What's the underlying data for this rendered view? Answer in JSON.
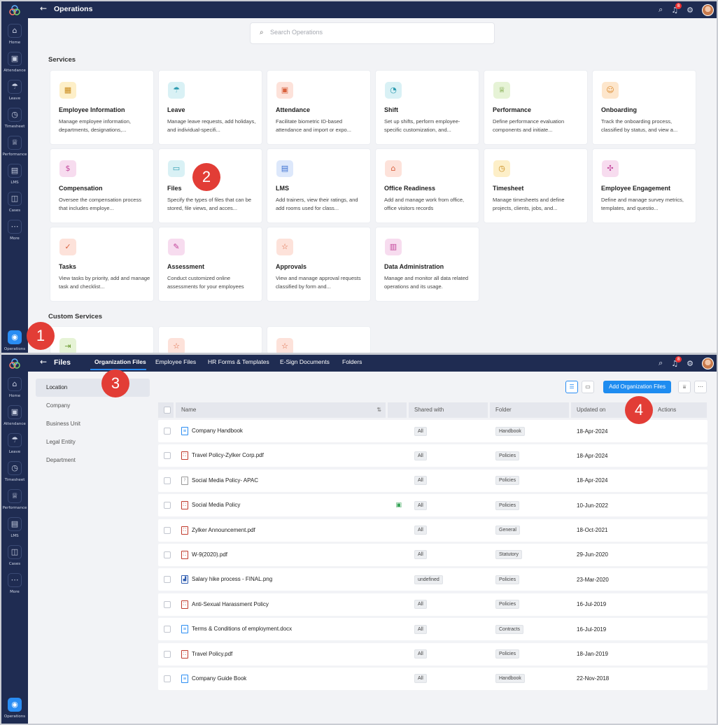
{
  "operations_view": {
    "rail": [
      {
        "label": "Home",
        "icon": "home-icon",
        "glyph": "⌂"
      },
      {
        "label": "Attendance",
        "icon": "calendar-icon",
        "glyph": "▣"
      },
      {
        "label": "Leave",
        "icon": "umbrella-icon",
        "glyph": "☂"
      },
      {
        "label": "Timesheet",
        "icon": "clock-icon",
        "glyph": "◷"
      },
      {
        "label": "Performance",
        "icon": "trophy-icon",
        "glyph": "♕"
      },
      {
        "label": "LMS",
        "icon": "monitor-icon",
        "glyph": "▤"
      },
      {
        "label": "Cases",
        "icon": "cases-icon",
        "glyph": "◫"
      },
      {
        "label": "More",
        "icon": "more-icon",
        "glyph": "⋯"
      }
    ],
    "rail_active": {
      "label": "Operations",
      "icon": "operations-icon",
      "glyph": "◉"
    },
    "title": "Operations",
    "notification_count": "8",
    "search_placeholder": "Search Operations",
    "services_title": "Services",
    "services": [
      {
        "title": "Employee Information",
        "desc": "Manage employee information, departments, designations,...",
        "icon": "id-card-icon",
        "glyph": "▦",
        "bg": "#fdefc8",
        "fg": "#c98a1a"
      },
      {
        "title": "Leave",
        "desc": "Manage leave requests, add holidays, and individual-specifi...",
        "icon": "umbrella-icon",
        "glyph": "☂",
        "bg": "#d9f1f5",
        "fg": "#2c9bb0"
      },
      {
        "title": "Attendance",
        "desc": "Facilitate biometric ID-based attendance and import or expo...",
        "icon": "calendar-icon",
        "glyph": "▣",
        "bg": "#fde2da",
        "fg": "#d9613e"
      },
      {
        "title": "Shift",
        "desc": "Set up shifts, perform employee-specific customization, and...",
        "icon": "shift-icon",
        "glyph": "◔",
        "bg": "#d9f1f5",
        "fg": "#2c9bb0"
      },
      {
        "title": "Performance",
        "desc": "Define performance evaluation components and initiate...",
        "icon": "trophy-icon",
        "glyph": "♕",
        "bg": "#e6f3d6",
        "fg": "#6a9a2e"
      },
      {
        "title": "Onboarding",
        "desc": "Track the onboarding process, classified by status, and view a...",
        "icon": "onboarding-icon",
        "glyph": "☺",
        "bg": "#fde6cc",
        "fg": "#d98526"
      },
      {
        "title": "Compensation",
        "desc": "Oversee the compensation process that includes employe...",
        "icon": "money-icon",
        "glyph": "$",
        "bg": "#f7dcef",
        "fg": "#c2449a"
      },
      {
        "title": "Files",
        "desc": "Specify the types of files that can be stored, file views, and acces...",
        "icon": "folder-icon",
        "glyph": "▭",
        "bg": "#d9f1f5",
        "fg": "#2c9bb0"
      },
      {
        "title": "LMS",
        "desc": "Add trainers, view their ratings, and add rooms used for class...",
        "icon": "monitor-icon",
        "glyph": "▤",
        "bg": "#dde8fb",
        "fg": "#3b6fd1"
      },
      {
        "title": "Office Readiness",
        "desc": "Add and manage work from office, office visitors records",
        "icon": "office-icon",
        "glyph": "⌂",
        "bg": "#fde2da",
        "fg": "#d9613e"
      },
      {
        "title": "Timesheet",
        "desc": "Manage timesheets and define projects, clients, jobs, and...",
        "icon": "clock-icon",
        "glyph": "◷",
        "bg": "#fdefc8",
        "fg": "#c98a1a"
      },
      {
        "title": "Employee Engagement",
        "desc": "Define and manage survey metrics, templates, and questio...",
        "icon": "engagement-icon",
        "glyph": "✣",
        "bg": "#f7dcef",
        "fg": "#c2449a"
      },
      {
        "title": "Tasks",
        "desc": "View tasks by priority, add and manage task and checklist...",
        "icon": "tasks-icon",
        "glyph": "✓",
        "bg": "#fde2da",
        "fg": "#d9613e"
      },
      {
        "title": "Assessment",
        "desc": "Conduct customized online assessments for your employees",
        "icon": "assessment-icon",
        "glyph": "✎",
        "bg": "#f7dcef",
        "fg": "#c2449a"
      },
      {
        "title": "Approvals",
        "desc": "View and manage approval requests classified by form and...",
        "icon": "star-icon",
        "glyph": "☆",
        "bg": "#fde2da",
        "fg": "#d9613e"
      },
      {
        "title": "Data Administration",
        "desc": "Manage and monitor all data related operations and its usage.",
        "icon": "data-icon",
        "glyph": "▥",
        "bg": "#f7dcef",
        "fg": "#c2449a"
      }
    ],
    "custom_title": "Custom Services",
    "custom_services": [
      {
        "icon": "custom-service-icon",
        "glyph": "⇥",
        "bg": "#e6f3d6",
        "fg": "#6a9a2e"
      },
      {
        "icon": "star-icon",
        "glyph": "☆",
        "bg": "#fde2da",
        "fg": "#d9613e"
      },
      {
        "icon": "star-icon",
        "glyph": "☆",
        "bg": "#fde2da",
        "fg": "#d9613e"
      }
    ]
  },
  "files_view": {
    "rail": [
      {
        "label": "Home",
        "icon": "home-icon",
        "glyph": "⌂"
      },
      {
        "label": "Attendance",
        "icon": "calendar-icon",
        "glyph": "▣"
      },
      {
        "label": "Leave",
        "icon": "umbrella-icon",
        "glyph": "☂"
      },
      {
        "label": "Timesheet",
        "icon": "clock-icon",
        "glyph": "◷"
      },
      {
        "label": "Performance",
        "icon": "trophy-icon",
        "glyph": "♕"
      },
      {
        "label": "LMS",
        "icon": "monitor-icon",
        "glyph": "▤"
      },
      {
        "label": "Cases",
        "icon": "cases-icon",
        "glyph": "◫"
      },
      {
        "label": "More",
        "icon": "more-icon",
        "glyph": "⋯"
      }
    ],
    "rail_active": {
      "label": "Operations",
      "icon": "operations-icon",
      "glyph": "◉"
    },
    "title": "Files",
    "notification_count": "8",
    "tabs": [
      "Organization Files",
      "Employee Files",
      "HR Forms & Templates",
      "E-Sign Documents",
      "Folders"
    ],
    "left_nav": [
      "Location",
      "Company",
      "Business Unit",
      "Legal Entity",
      "Department"
    ],
    "add_button": "Add Organization Files",
    "columns": [
      "Name",
      "Shared with",
      "Folder",
      "Updated on",
      "Actions"
    ],
    "rows": [
      {
        "name": "Company Handbook",
        "type": "doc",
        "shared": "All",
        "folder": "Handbook",
        "updated": "18-Apr-2024"
      },
      {
        "name": "Travel Policy-Zylker Corp.pdf",
        "type": "pdf",
        "shared": "All",
        "folder": "Policies",
        "updated": "18-Apr-2024"
      },
      {
        "name": "Social Media Policy- APAC",
        "type": "gen",
        "shared": "All",
        "folder": "Policies",
        "updated": "18-Apr-2024"
      },
      {
        "name": "Social Media Policy",
        "type": "pdf",
        "shared": "All",
        "folder": "Policies",
        "updated": "10-Jun-2022",
        "note": true
      },
      {
        "name": "Zylker Announcement.pdf",
        "type": "pdf",
        "shared": "All",
        "folder": "General",
        "updated": "18-Oct-2021"
      },
      {
        "name": "W-9(2020).pdf",
        "type": "pdf",
        "shared": "All",
        "folder": "Statutory",
        "updated": "29-Jun-2020"
      },
      {
        "name": "Salary hike process - FINAL.png",
        "type": "img",
        "shared": "undefined",
        "folder": "Policies",
        "updated": "23-Mar-2020"
      },
      {
        "name": "Anti-Sexual Harassment Policy",
        "type": "pdf",
        "shared": "All",
        "folder": "Policies",
        "updated": "16-Jul-2019"
      },
      {
        "name": "Terms & Conditions of employment.docx",
        "type": "doc",
        "shared": "All",
        "folder": "Contracts",
        "updated": "16-Jul-2019"
      },
      {
        "name": "Travel Policy.pdf",
        "type": "pdf",
        "shared": "All",
        "folder": "Policies",
        "updated": "18-Jan-2019"
      },
      {
        "name": "Company Guide Book",
        "type": "doc",
        "shared": "All",
        "folder": "Handbook",
        "updated": "22-Nov-2018"
      }
    ]
  },
  "callouts": [
    "1",
    "2",
    "3",
    "4"
  ]
}
